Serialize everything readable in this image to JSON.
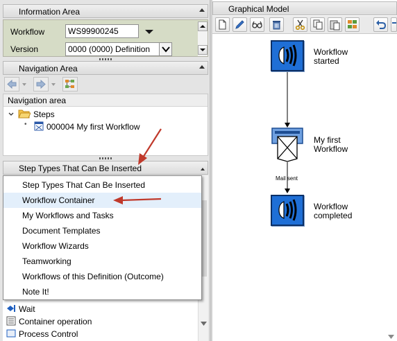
{
  "info_area": {
    "title": "Information Area",
    "workflow_label": "Workflow",
    "workflow_value": "WS99900245",
    "version_label": "Version",
    "version_value": "0000 (0000) Definition"
  },
  "nav_area_panel": {
    "title": "Navigation Area"
  },
  "navigation": {
    "header": "Navigation area",
    "steps_label": "Steps",
    "item_label": "000004 My first Workflow"
  },
  "step_types": {
    "title": "Step Types That Can Be Inserted",
    "menu": [
      "Step Types That Can Be Inserted",
      "Workflow Container",
      "My Workflows and Tasks",
      "Document Templates",
      "Workflow Wizards",
      "Teamworking",
      "Workflows of this Definition (Outcome)",
      "Note It!"
    ],
    "list_items": [
      "Wait",
      "Container operation",
      "Process Control"
    ]
  },
  "graphical_model": {
    "title": "Graphical Model",
    "nodes": {
      "start": "Workflow\nstarted",
      "step": "My first\nWorkflow",
      "end": "Workflow\ncompleted"
    },
    "edge_label": "Mail sent"
  },
  "colors": {
    "event_blue": "#1f6fd6",
    "annotation_arrow": "#c0392b",
    "panel_bg": "#e4e4e4",
    "menu_highlight": "#e3effb"
  },
  "icons": {
    "toolbar": [
      "new-document-icon",
      "edit-pencil-icon",
      "glasses-display-icon",
      "trash-icon",
      "cut-scissors-icon",
      "copy-icon",
      "paste-icon",
      "insert-icon",
      "undo-icon",
      "redo-icon"
    ],
    "navigation": [
      "back-arrow-icon",
      "forward-arrow-icon",
      "structure-icon"
    ],
    "tree": [
      "expand-chevron-icon",
      "folder-icon",
      "workflow-step-icon"
    ],
    "list": [
      "wait-icon",
      "container-operation-icon",
      "process-control-icon"
    ],
    "nodes": [
      "event-icon",
      "mail-step-icon",
      "event-icon"
    ]
  }
}
